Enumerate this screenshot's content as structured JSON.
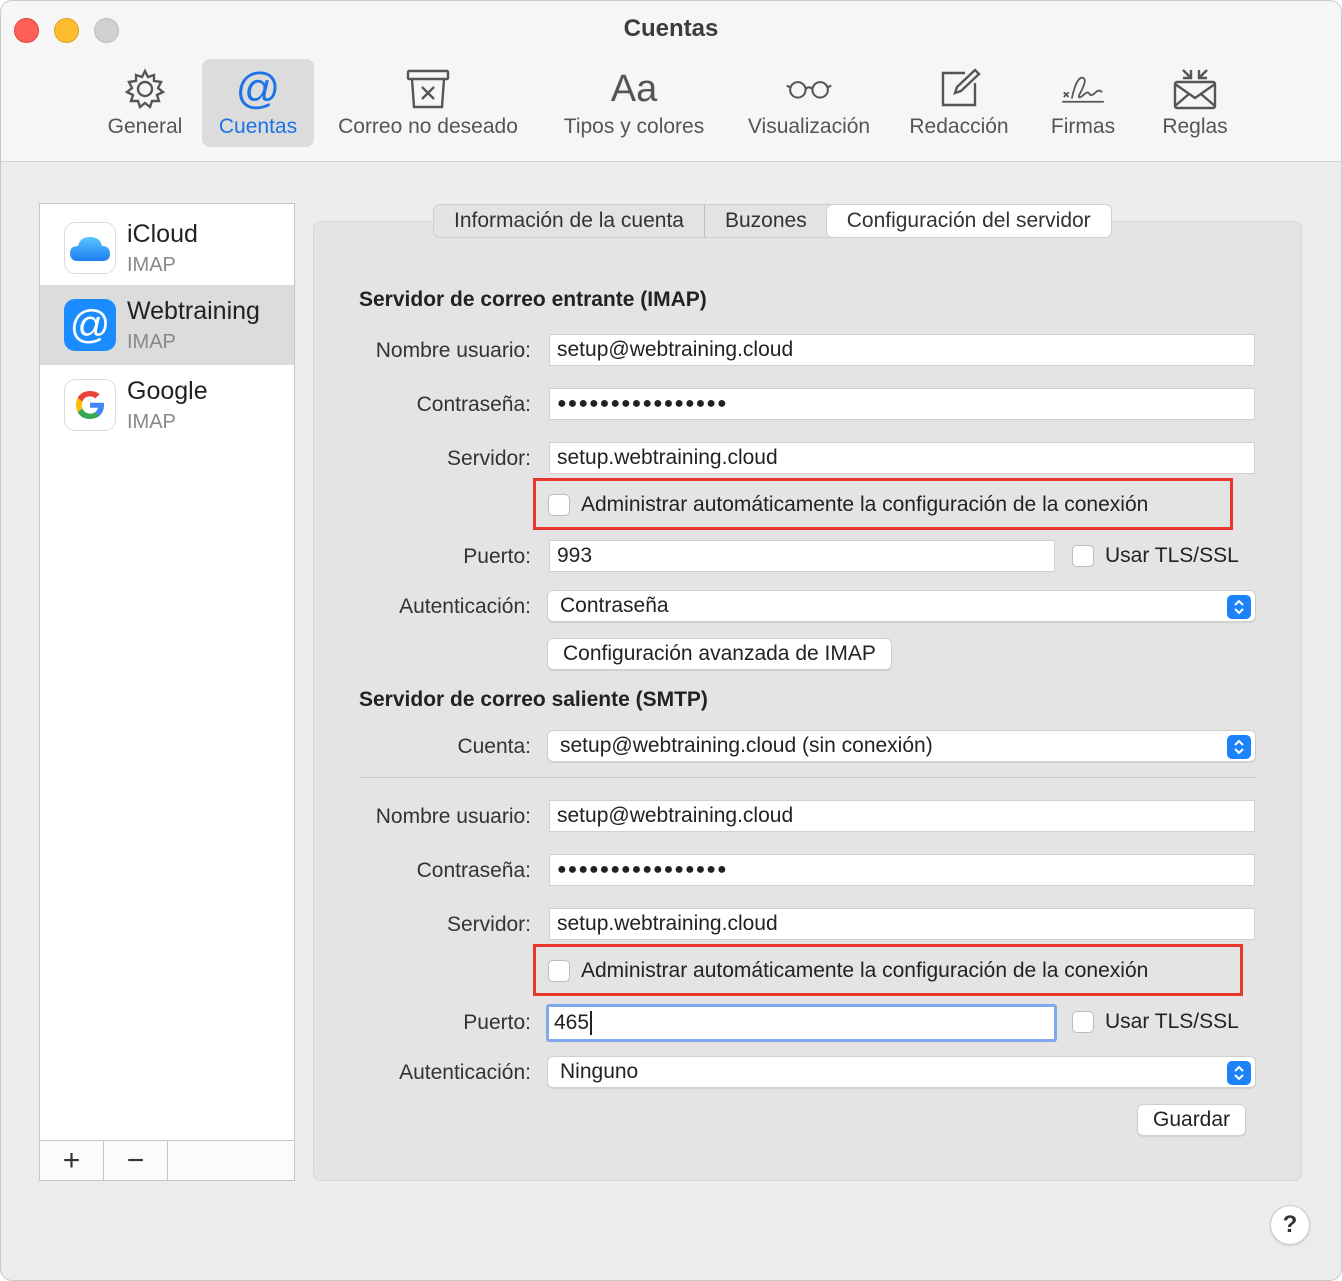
{
  "window": {
    "title": "Cuentas"
  },
  "toolbar": {
    "items": [
      {
        "label": "General",
        "icon": "gear-icon"
      },
      {
        "label": "Cuentas",
        "icon": "at-icon",
        "selected": true
      },
      {
        "label": "Correo no deseado",
        "icon": "junk-icon"
      },
      {
        "label": "Tipos y colores",
        "icon": "fonts-icon",
        "glyph": "Aa"
      },
      {
        "label": "Visualización",
        "icon": "glasses-icon"
      },
      {
        "label": "Redacción",
        "icon": "compose-icon"
      },
      {
        "label": "Firmas",
        "icon": "signature-icon"
      },
      {
        "label": "Reglas",
        "icon": "rules-icon"
      }
    ]
  },
  "sidebar": {
    "accounts": [
      {
        "name": "iCloud",
        "type": "IMAP",
        "icon": "icloud-icon"
      },
      {
        "name": "Webtraining",
        "type": "IMAP",
        "icon": "at-icon",
        "selected": true
      },
      {
        "name": "Google",
        "type": "IMAP",
        "icon": "google-icon"
      }
    ],
    "add_label": "+",
    "remove_label": "−"
  },
  "tabs": [
    {
      "label": "Información de la cuenta"
    },
    {
      "label": "Buzones"
    },
    {
      "label": "Configuración del servidor",
      "selected": true
    }
  ],
  "incoming": {
    "title": "Servidor de correo entrante (IMAP)",
    "username_label": "Nombre usuario:",
    "username": "setup@webtraining.cloud",
    "password_label": "Contraseña:",
    "password": "●●●●●●●●●●●●●●●●",
    "server_label": "Servidor:",
    "server": "setup.webtraining.cloud",
    "auto_manage_label": "Administrar automáticamente la configuración de la conexión",
    "port_label": "Puerto:",
    "port": "993",
    "tls_label": "Usar TLS/SSL",
    "auth_label": "Autenticación:",
    "auth": "Contraseña",
    "advanced_button": "Configuración avanzada de IMAP"
  },
  "outgoing": {
    "title": "Servidor de correo saliente (SMTP)",
    "account_label": "Cuenta:",
    "account": "setup@webtraining.cloud (sin conexión)",
    "username_label": "Nombre usuario:",
    "username": "setup@webtraining.cloud",
    "password_label": "Contraseña:",
    "password": "●●●●●●●●●●●●●●●●",
    "server_label": "Servidor:",
    "server": "setup.webtraining.cloud",
    "auto_manage_label": "Administrar automáticamente la configuración de la conexión",
    "port_label": "Puerto:",
    "port": "465",
    "tls_label": "Usar TLS/SSL",
    "auth_label": "Autenticación:",
    "auth": "Ninguno",
    "save_button": "Guardar"
  },
  "help": {
    "label": "?"
  },
  "colors": {
    "accent": "#1a73e8",
    "highlight_box": "#e8372a",
    "select_arrow": "#1a82fb"
  }
}
